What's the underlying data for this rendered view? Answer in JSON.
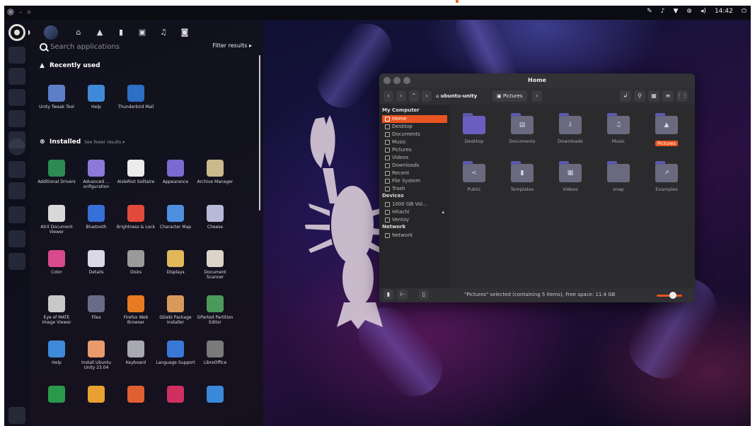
{
  "panel": {
    "clock": "14:42",
    "indicators": [
      "pen-icon",
      "bell-icon",
      "wifi-icon",
      "accessibility-icon",
      "volume-icon",
      "power-icon"
    ]
  },
  "dash": {
    "search_placeholder": "Search applications",
    "filter_label": "Filter results ▸",
    "recent_header": "Recently used",
    "installed_header": "Installed",
    "installed_sub": "See fewer results ▾",
    "recent_apps": [
      {
        "label": "Unity Tweak Tool",
        "color": "#5e7ec7"
      },
      {
        "label": "Help",
        "color": "#3f8ad8"
      },
      {
        "label": "Thunderbird Mail",
        "color": "#2c6fc4"
      }
    ],
    "installed_apps": [
      {
        "label": "Additional Drivers",
        "color": "#2d8a52"
      },
      {
        "label": "Advanced ... onfiguration",
        "color": "#8c79d9"
      },
      {
        "label": "AisleRiot Solitaire",
        "color": "#ececec"
      },
      {
        "label": "Appearance",
        "color": "#7b6ad2"
      },
      {
        "label": "Archive Manager",
        "color": "#c9b98c"
      },
      {
        "label": "Atril Document Viewer",
        "color": "#d8d8d8"
      },
      {
        "label": "Bluetooth",
        "color": "#3670d8"
      },
      {
        "label": "Brightness & Lock",
        "color": "#e24b3b"
      },
      {
        "label": "Character Map",
        "color": "#4f8fe0"
      },
      {
        "label": "Cheese",
        "color": "#b8b8d8"
      },
      {
        "label": "Color",
        "color": "#d84a8c"
      },
      {
        "label": "Details",
        "color": "#d8d8e8"
      },
      {
        "label": "Disks",
        "color": "#9a9a9a"
      },
      {
        "label": "Displays",
        "color": "#e0b85a"
      },
      {
        "label": "Document Scanner",
        "color": "#dcd4c8"
      },
      {
        "label": "Eye of MATE Image Viewer",
        "color": "#c8c8c8"
      },
      {
        "label": "Files",
        "color": "#6a6a8a"
      },
      {
        "label": "Firefox Web Browser",
        "color": "#e87a22"
      },
      {
        "label": "GDebi Package Installer",
        "color": "#d89a5a"
      },
      {
        "label": "GParted Partition Editor",
        "color": "#4a9a5a"
      },
      {
        "label": "Help",
        "color": "#3f8ad8"
      },
      {
        "label": "Install Ubuntu Unity 23.04",
        "color": "#e89a6a"
      },
      {
        "label": "Keyboard",
        "color": "#a8a8b0"
      },
      {
        "label": "Language Support",
        "color": "#3a78d8"
      },
      {
        "label": "LibreOffice",
        "color": "#7a7a7a"
      },
      {
        "label": "",
        "color": "#2a9a4a"
      },
      {
        "label": "",
        "color": "#e8a030"
      },
      {
        "label": "",
        "color": "#e06030"
      },
      {
        "label": "",
        "color": "#d03060"
      },
      {
        "label": "",
        "color": "#3a88d8"
      }
    ]
  },
  "files": {
    "window_title": "Home",
    "breadcrumbs": [
      "ubuntu-unity",
      "Pictures"
    ],
    "sidebar": {
      "my_computer": "My Computer",
      "places": [
        "Home",
        "Desktop",
        "Documents",
        "Music",
        "Pictures",
        "Videos",
        "Downloads",
        "Recent",
        "File System",
        "Trash"
      ],
      "devices_header": "Devices",
      "devices": [
        "1000 GB Vol...",
        "Hitachi",
        "Ventoy"
      ],
      "network_header": "Network",
      "network": [
        "Network"
      ]
    },
    "folders": [
      {
        "name": "Desktop",
        "glyph": ""
      },
      {
        "name": "Documents",
        "glyph": "▤"
      },
      {
        "name": "Downloads",
        "glyph": "⇩"
      },
      {
        "name": "Music",
        "glyph": "♫"
      },
      {
        "name": "Pictures",
        "glyph": "▲"
      },
      {
        "name": "Public",
        "glyph": "<"
      },
      {
        "name": "Templates",
        "glyph": "▮"
      },
      {
        "name": "Videos",
        "glyph": "▦"
      },
      {
        "name": "snap",
        "glyph": ""
      },
      {
        "name": "Examples",
        "glyph": "↗"
      }
    ],
    "status": "\"Pictures\" selected (containing 5 items), Free space: 11.4 GB",
    "zoom_level": 0.65
  },
  "colors": {
    "accent": "#e95420",
    "folder": "#6a6a7e"
  }
}
